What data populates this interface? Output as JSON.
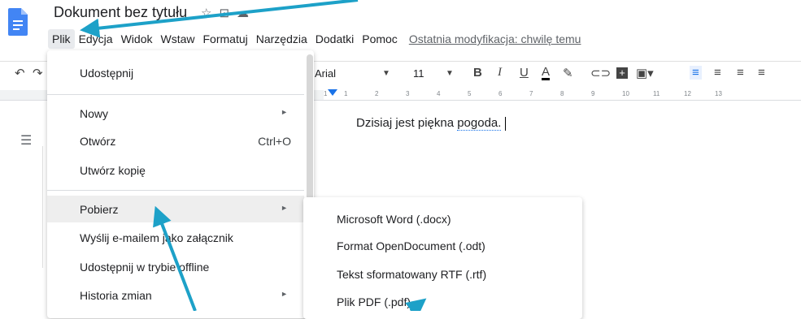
{
  "header": {
    "doc_title": "Dokument bez tytułu",
    "last_modified": "Ostatnia modyfikacja: chwilę temu"
  },
  "menubar": [
    {
      "label": "Plik"
    },
    {
      "label": "Edycja"
    },
    {
      "label": "Widok"
    },
    {
      "label": "Wstaw"
    },
    {
      "label": "Formatuj"
    },
    {
      "label": "Narzędzia"
    },
    {
      "label": "Dodatki"
    },
    {
      "label": "Pomoc"
    }
  ],
  "toolbar": {
    "font": "Arial",
    "font_size": "11"
  },
  "ruler": [
    "1",
    "1",
    "2",
    "3",
    "4",
    "5",
    "6",
    "7",
    "8",
    "9",
    "10",
    "11",
    "12",
    "13"
  ],
  "document": {
    "text_before": "Dzisiaj jest piękna ",
    "text_marked": "pogoda."
  },
  "file_menu": {
    "share": "Udostępnij",
    "new": "Nowy",
    "open": "Otwórz",
    "open_shortcut": "Ctrl+O",
    "copy": "Utwórz kopię",
    "download": "Pobierz",
    "email": "Wyślij e-mailem jako załącznik",
    "offline": "Udostępnij w trybie offline",
    "history": "Historia zmian"
  },
  "download_submenu": [
    {
      "label": "Microsoft Word (.docx)"
    },
    {
      "label": "Format OpenDocument (.odt)"
    },
    {
      "label": "Tekst sformatowany RTF (.rtf)"
    },
    {
      "label": "Plik PDF (.pdf)"
    }
  ],
  "colors": {
    "docs_blue": "#4285f4",
    "annotation_arrow": "#1da1c8",
    "ruler_blue": "#1a73e8"
  }
}
